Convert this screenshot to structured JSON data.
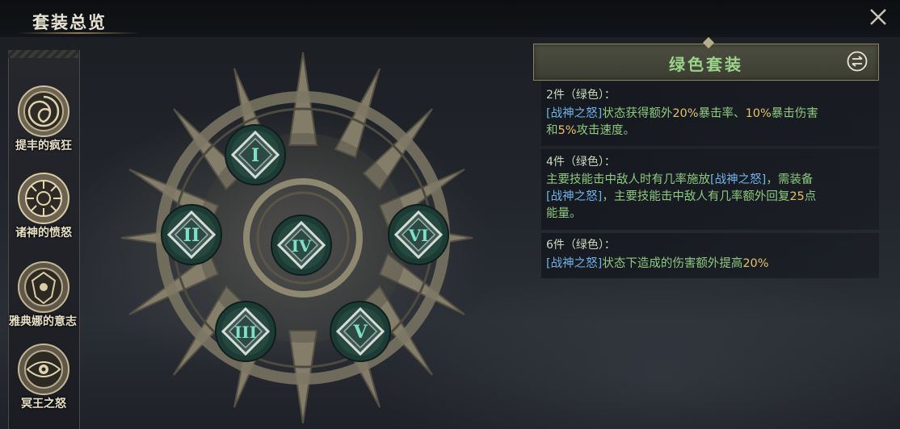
{
  "header": {
    "title": "套装总览"
  },
  "sidebar": {
    "items": [
      {
        "label": "提丰的疯狂"
      },
      {
        "label": "诸神的愤怒"
      },
      {
        "label": "雅典娜的意志"
      },
      {
        "label": "冥王之怒"
      }
    ]
  },
  "emblem": {
    "slots": [
      {
        "numeral": "I"
      },
      {
        "numeral": "II"
      },
      {
        "numeral": "III"
      },
      {
        "numeral": "IV"
      },
      {
        "numeral": "V"
      },
      {
        "numeral": "VI"
      }
    ]
  },
  "set_panel": {
    "title": "绿色套装",
    "bonuses": [
      {
        "head": "2件（绿色）：",
        "line1_tag": "[战神之怒]",
        "line1_a": "状态获得额外",
        "line1_n1": "20%",
        "line1_b": "暴击率、",
        "line1_n2": "10%",
        "line1_c": "暴击伤害",
        "line2_a": "和",
        "line2_n": "5%",
        "line2_b": "攻击速度。"
      },
      {
        "head": "4件（绿色）：",
        "line1_a": "主要技能击中敌人时有几率施放",
        "line1_tag": "[战神之怒]",
        "line1_b": "，需装备",
        "line2_tag": "[战神之怒]",
        "line2_a": "，主要技能击中敌人有几率额外回复",
        "line2_n": "25",
        "line2_b": "点",
        "line3": "能量。"
      },
      {
        "head": "6件（绿色）：",
        "line1_tag": "[战神之怒]",
        "line1_a": "状态下造成的伤害额外提高",
        "line1_n": "20%"
      }
    ]
  },
  "colors": {
    "accent_green": "#8dc97e",
    "tag_blue": "#6fb3e6",
    "number_gold": "#e3c36a"
  }
}
